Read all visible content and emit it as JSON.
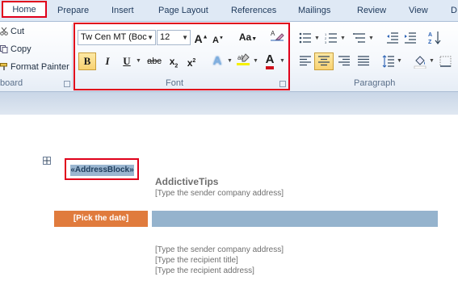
{
  "tabs": [
    "Home",
    "Prepare",
    "Insert",
    "Page Layout",
    "References",
    "Mailings",
    "Review",
    "View",
    "D"
  ],
  "clipboard": {
    "cut_label": "Cut",
    "copy_label": "Copy",
    "format_painter_label": "Format Painter",
    "group_label": "board"
  },
  "font_group": {
    "font_name": "Tw Cen MT (Boc",
    "font_size": "12",
    "change_case_label": "Aa",
    "group_label": "Font"
  },
  "paragraph_group": {
    "group_label": "Paragraph"
  },
  "document": {
    "address_block": "«AddressBlock»",
    "company_name": "AddictiveTips",
    "sender_address_1": "[Type the sender company address]",
    "date_field": "[Pick the date]",
    "sender_address_2": "[Type the sender company address]",
    "recipient_title": "[Type the recipient title]",
    "recipient_address": "[Type the recipient address]"
  },
  "colors": {
    "highlight_box": "#e0001b",
    "date_bar": "#e07b3d",
    "blue_bar": "#95b3cd",
    "active_button": "#f8d272"
  }
}
